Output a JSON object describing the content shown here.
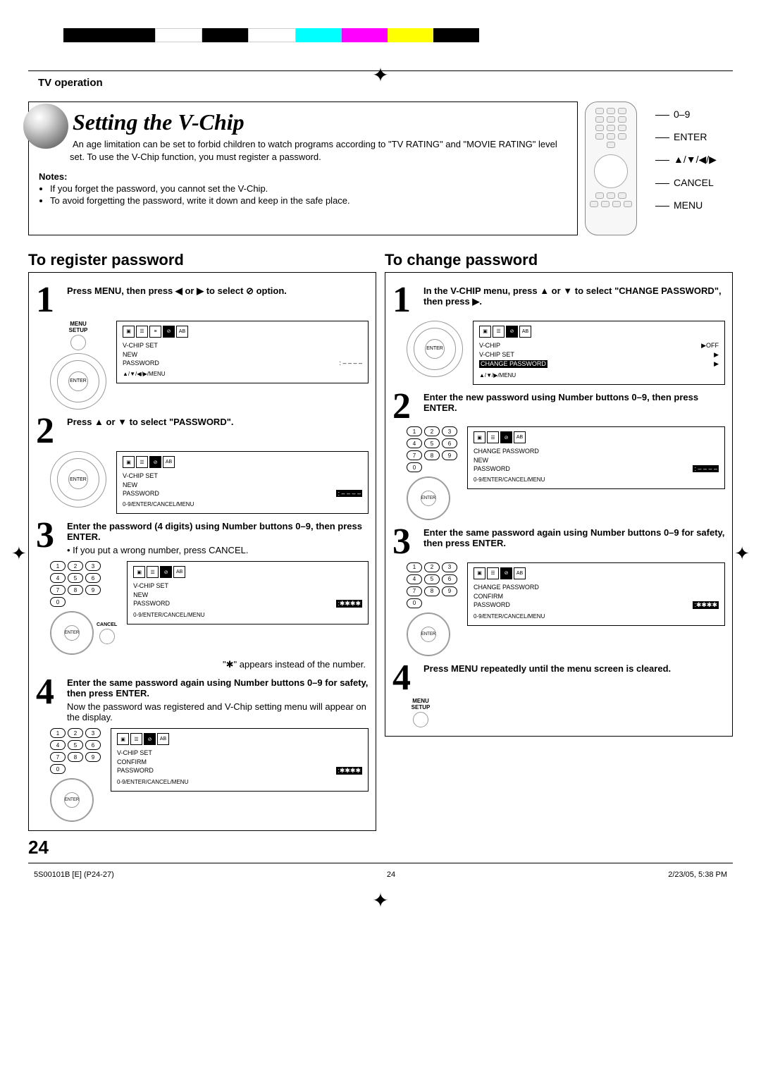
{
  "section": "TV operation",
  "title": "Setting the V-Chip",
  "intro": "An age limitation can be set to forbid children to watch programs according to \"TV RATING\" and \"MOVIE RATING\" level set. To use the V-Chip function, you must register a password.",
  "notes_title": "Notes:",
  "notes": [
    "If you forget the password, you cannot set the V-Chip.",
    "To avoid forgetting the password, write it down and keep in the safe place."
  ],
  "remote_labels": [
    "0–9",
    "ENTER",
    "▲/▼/◀/▶",
    "CANCEL",
    "MENU"
  ],
  "left": {
    "heading": "To register password",
    "s1": "Press MENU, then press ◀ or ▶ to select ⊘ option.",
    "s2": "Press ▲ or ▼ to select \"PASSWORD\".",
    "s3": "Enter the password (4 digits) using Number buttons 0–9, then press ENTER.",
    "s3_note": "If you put a wrong number, press CANCEL.",
    "s3_foot": "\"✱\" appears instead of the number.",
    "s4": "Enter the same password again using Number buttons 0–9 for safety, then press ENTER.",
    "s4_note": "Now the password was registered and V-Chip setting menu will appear on the display."
  },
  "right": {
    "heading": "To change password",
    "s1": "In the V-CHIP menu, press ▲ or ▼ to select \"CHANGE PASSWORD\", then press ▶.",
    "s2": "Enter the new password using Number buttons 0–9, then press ENTER.",
    "s3": "Enter the same password again using Number buttons 0–9 for safety, then press ENTER.",
    "s4": "Press MENU repeatedly until the menu screen is cleared."
  },
  "osd": {
    "vchip_set": "V-CHIP SET",
    "new": "NEW",
    "password": "PASSWORD",
    "dashes": ": – – – –",
    "stars": ":✱✱✱✱",
    "confirm": "CONFIRM",
    "footer1": "▲/▼/◀/▶/MENU",
    "footer2": "0-9/ENTER/CANCEL/MENU",
    "footer3": "▲/▼/▶/MENU",
    "vchip": "V-CHIP",
    "off": "▶OFF",
    "change_pass": "CHANGE PASSWORD",
    "change_pass_sp": "CHANGE  PASSWORD",
    "arrow": "▶"
  },
  "dpad_center": "ENTER",
  "menu_setup": "MENU SETUP",
  "cancel_small": "CANCEL",
  "page_number": "24",
  "footer": {
    "doc": "5S00101B [E] (P24-27)",
    "pg": "24",
    "date": "2/23/05, 5:38 PM"
  }
}
